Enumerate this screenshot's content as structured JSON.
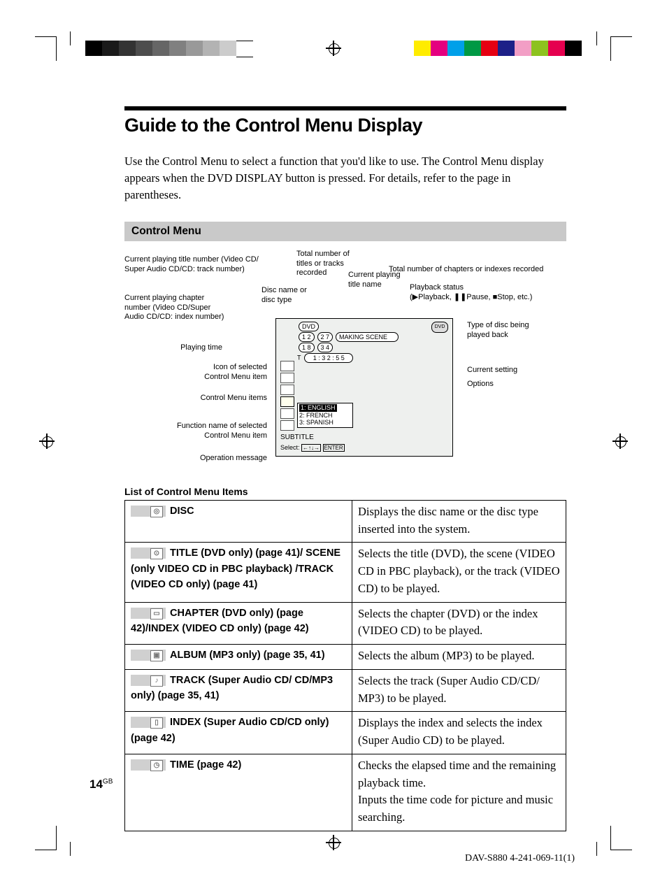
{
  "header": {
    "title": "Guide to the Control Menu Display",
    "intro": "Use the Control Menu to select a function that you'd like to use. The Control Menu display appears when the DVD DISPLAY button is pressed. For details, refer to the page in parentheses.",
    "section_title": "Control Menu"
  },
  "diagram_labels": {
    "l1": "Current playing title number (Video CD/\nSuper Audio CD/CD: track number)",
    "l2": "Current playing chapter\nnumber (Video CD/Super\nAudio CD/CD: index number)",
    "l3": "Playing time",
    "l4": "Icon of selected\nControl Menu item",
    "l5": "Control Menu items",
    "l6": "Function name of selected\nControl Menu item",
    "l7": "Operation message",
    "t1": "Disc name or\ndisc type",
    "t2": "Total number of\ntitles or tracks\nrecorded",
    "t3": "Current playing\ntitle name",
    "t4": "Total number of chapters or indexes recorded",
    "r1": "Playback status\n(▶Playback, ❚❚Pause, ■Stop, etc.)",
    "r2": "Type of disc being\nplayed back",
    "r3": "Current setting",
    "r4": "Options"
  },
  "screen": {
    "disc_label": "DVD",
    "title_cur": "1 2",
    "title_tot": "2 7",
    "title_name": "MAKING SCENE",
    "chap_cur": "1 8",
    "chap_tot": "3 4",
    "time_prefix": "T",
    "time_val": "1 : 3 2 : 5 5",
    "options": [
      "1: ENGLISH",
      "2: FRENCH",
      "3: SPANISH"
    ],
    "func_name": "SUBTITLE",
    "op_msg_prefix": "Select:",
    "op_msg_keys": "←↑↓→",
    "op_msg_enter": "ENTER",
    "disc_type": "DVD"
  },
  "list_heading": "List of Control Menu Items",
  "items": [
    {
      "name": "DISC",
      "desc": "Displays the disc name or the disc type inserted into the system."
    },
    {
      "name": "TITLE (DVD only) (page 41)/ SCENE (only VIDEO CD in PBC playback) /TRACK (VIDEO CD only) (page 41)",
      "desc": "Selects the title (DVD), the scene (VIDEO CD in PBC playback), or the track (VIDEO CD) to be played."
    },
    {
      "name": "CHAPTER (DVD only) (page 42)/INDEX (VIDEO CD only) (page 42)",
      "desc": "Selects the chapter (DVD) or the index (VIDEO CD) to be played."
    },
    {
      "name": "ALBUM (MP3 only) (page 35, 41)",
      "desc": "Selects the album (MP3) to be played."
    },
    {
      "name": "TRACK (Super Audio CD/ CD/MP3 only) (page 35, 41)",
      "desc": "Selects the track (Super Audio CD/CD/ MP3) to be played."
    },
    {
      "name": "INDEX (Super Audio CD/CD only) (page 42)",
      "desc": "Displays the index and selects the index (Super Audio CD) to be played."
    },
    {
      "name": "TIME (page 42)",
      "desc": "Checks the elapsed time and the remaining playback time.\nInputs the time code for picture and music searching."
    }
  ],
  "footer": {
    "page_number": "14",
    "page_region": "GB",
    "doc_id": "DAV-S880 4-241-069-11(1)"
  }
}
